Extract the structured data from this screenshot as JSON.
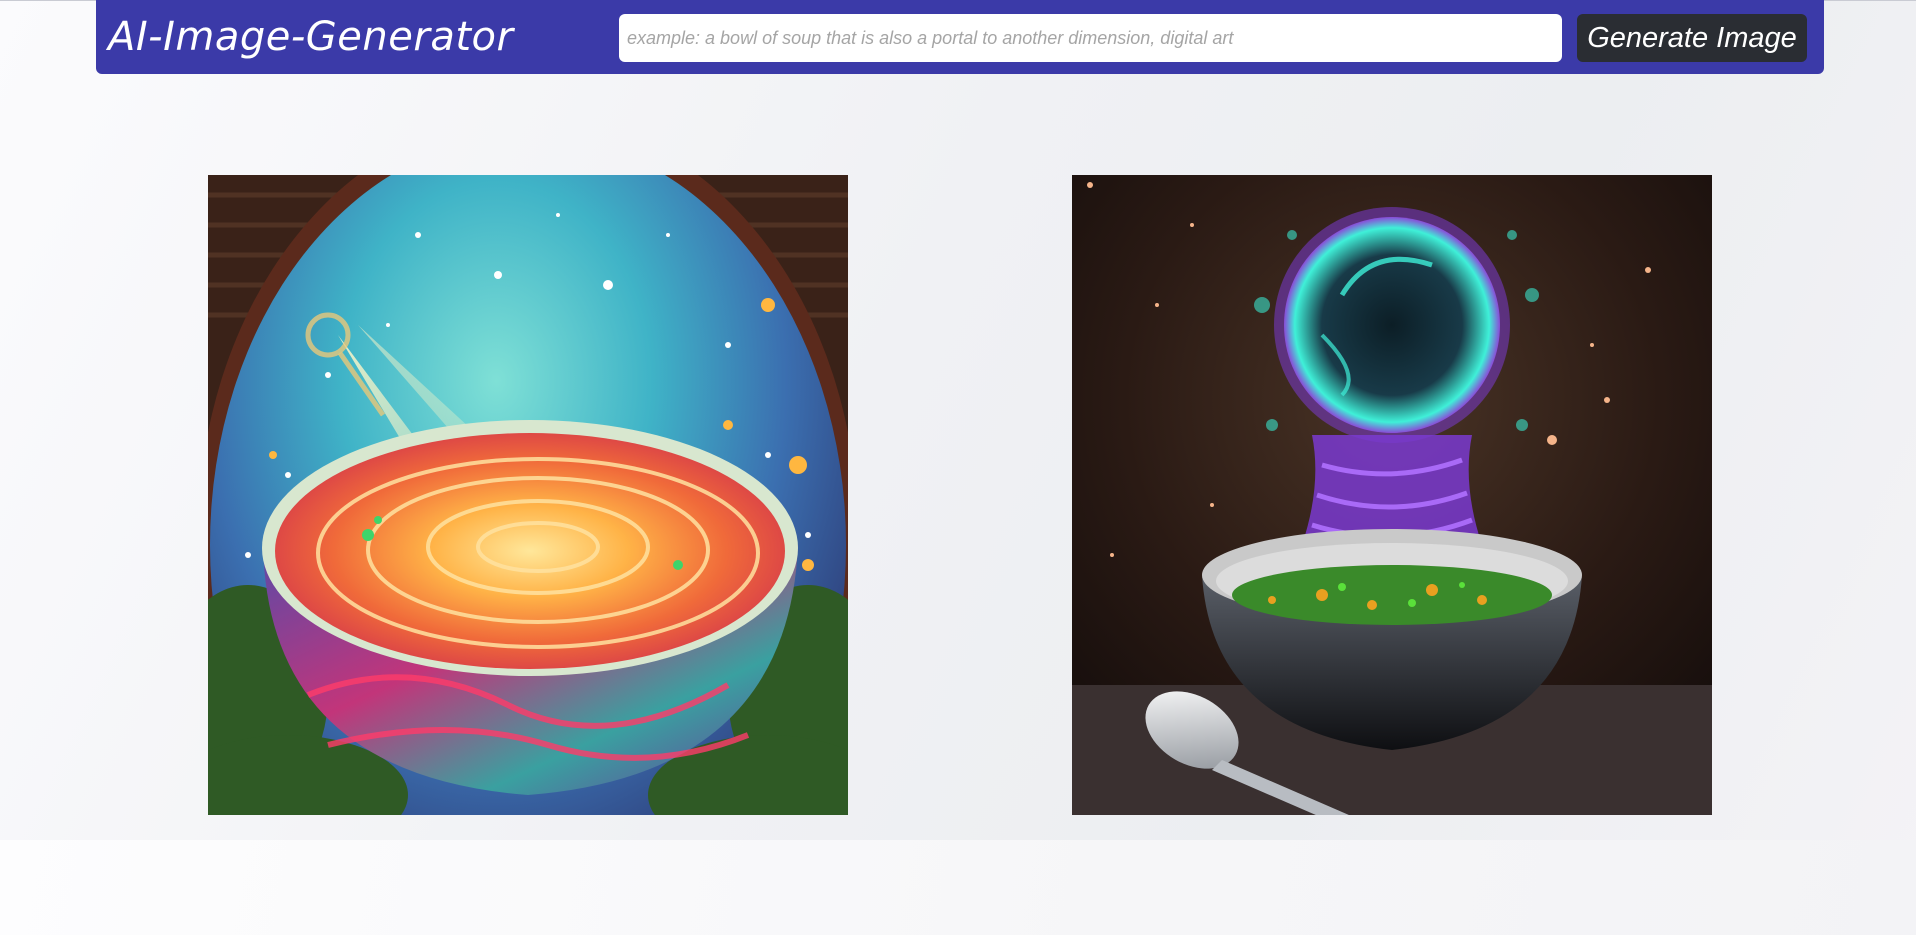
{
  "app": {
    "title": "AI-Image-Generator"
  },
  "prompt": {
    "value": "",
    "placeholder": "example: a bowl of soup that is also a portal to another dimension, digital art"
  },
  "actions": {
    "generate_label": "Generate Image"
  },
  "images": [
    {
      "name": "generated-image-1"
    },
    {
      "name": "generated-image-2"
    }
  ],
  "colors": {
    "navbar": "#3b3aa8",
    "button": "#2a2d33",
    "background": "#eef0f3"
  }
}
